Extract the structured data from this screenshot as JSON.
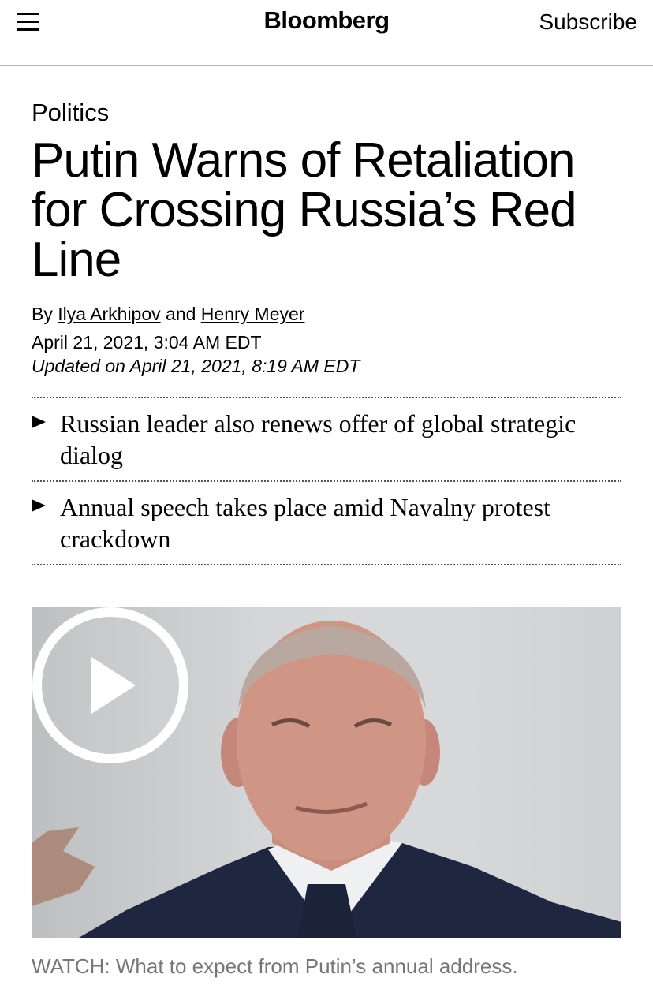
{
  "header": {
    "logo": "Bloomberg",
    "subscribe_label": "Subscribe"
  },
  "article": {
    "section": "Politics",
    "headline": "Putin Warns of Retaliation for Crossing Russia’s Red Line",
    "byline": {
      "prefix": "By",
      "author1": "Ilya Arkhipov",
      "joiner": "and",
      "author2": "Henry Meyer"
    },
    "published": "April 21, 2021, 3:04 AM EDT",
    "updated_prefix": "Updated on",
    "updated": "April 21, 2021, 8:19 AM EDT",
    "abstract": [
      "Russian leader also renews offer of global strategic dialog",
      "Annual speech takes place amid Navalny protest crackdown"
    ],
    "video_caption": "WATCH: What to expect from Putin’s annual address."
  },
  "icons": {
    "menu": "hamburger-menu-icon",
    "bullet": "triangle-bullet-icon",
    "play": "play-icon"
  },
  "colors": {
    "rule": "#b5b5b5",
    "caption": "#767676",
    "play_overlay": "#ffffff"
  }
}
